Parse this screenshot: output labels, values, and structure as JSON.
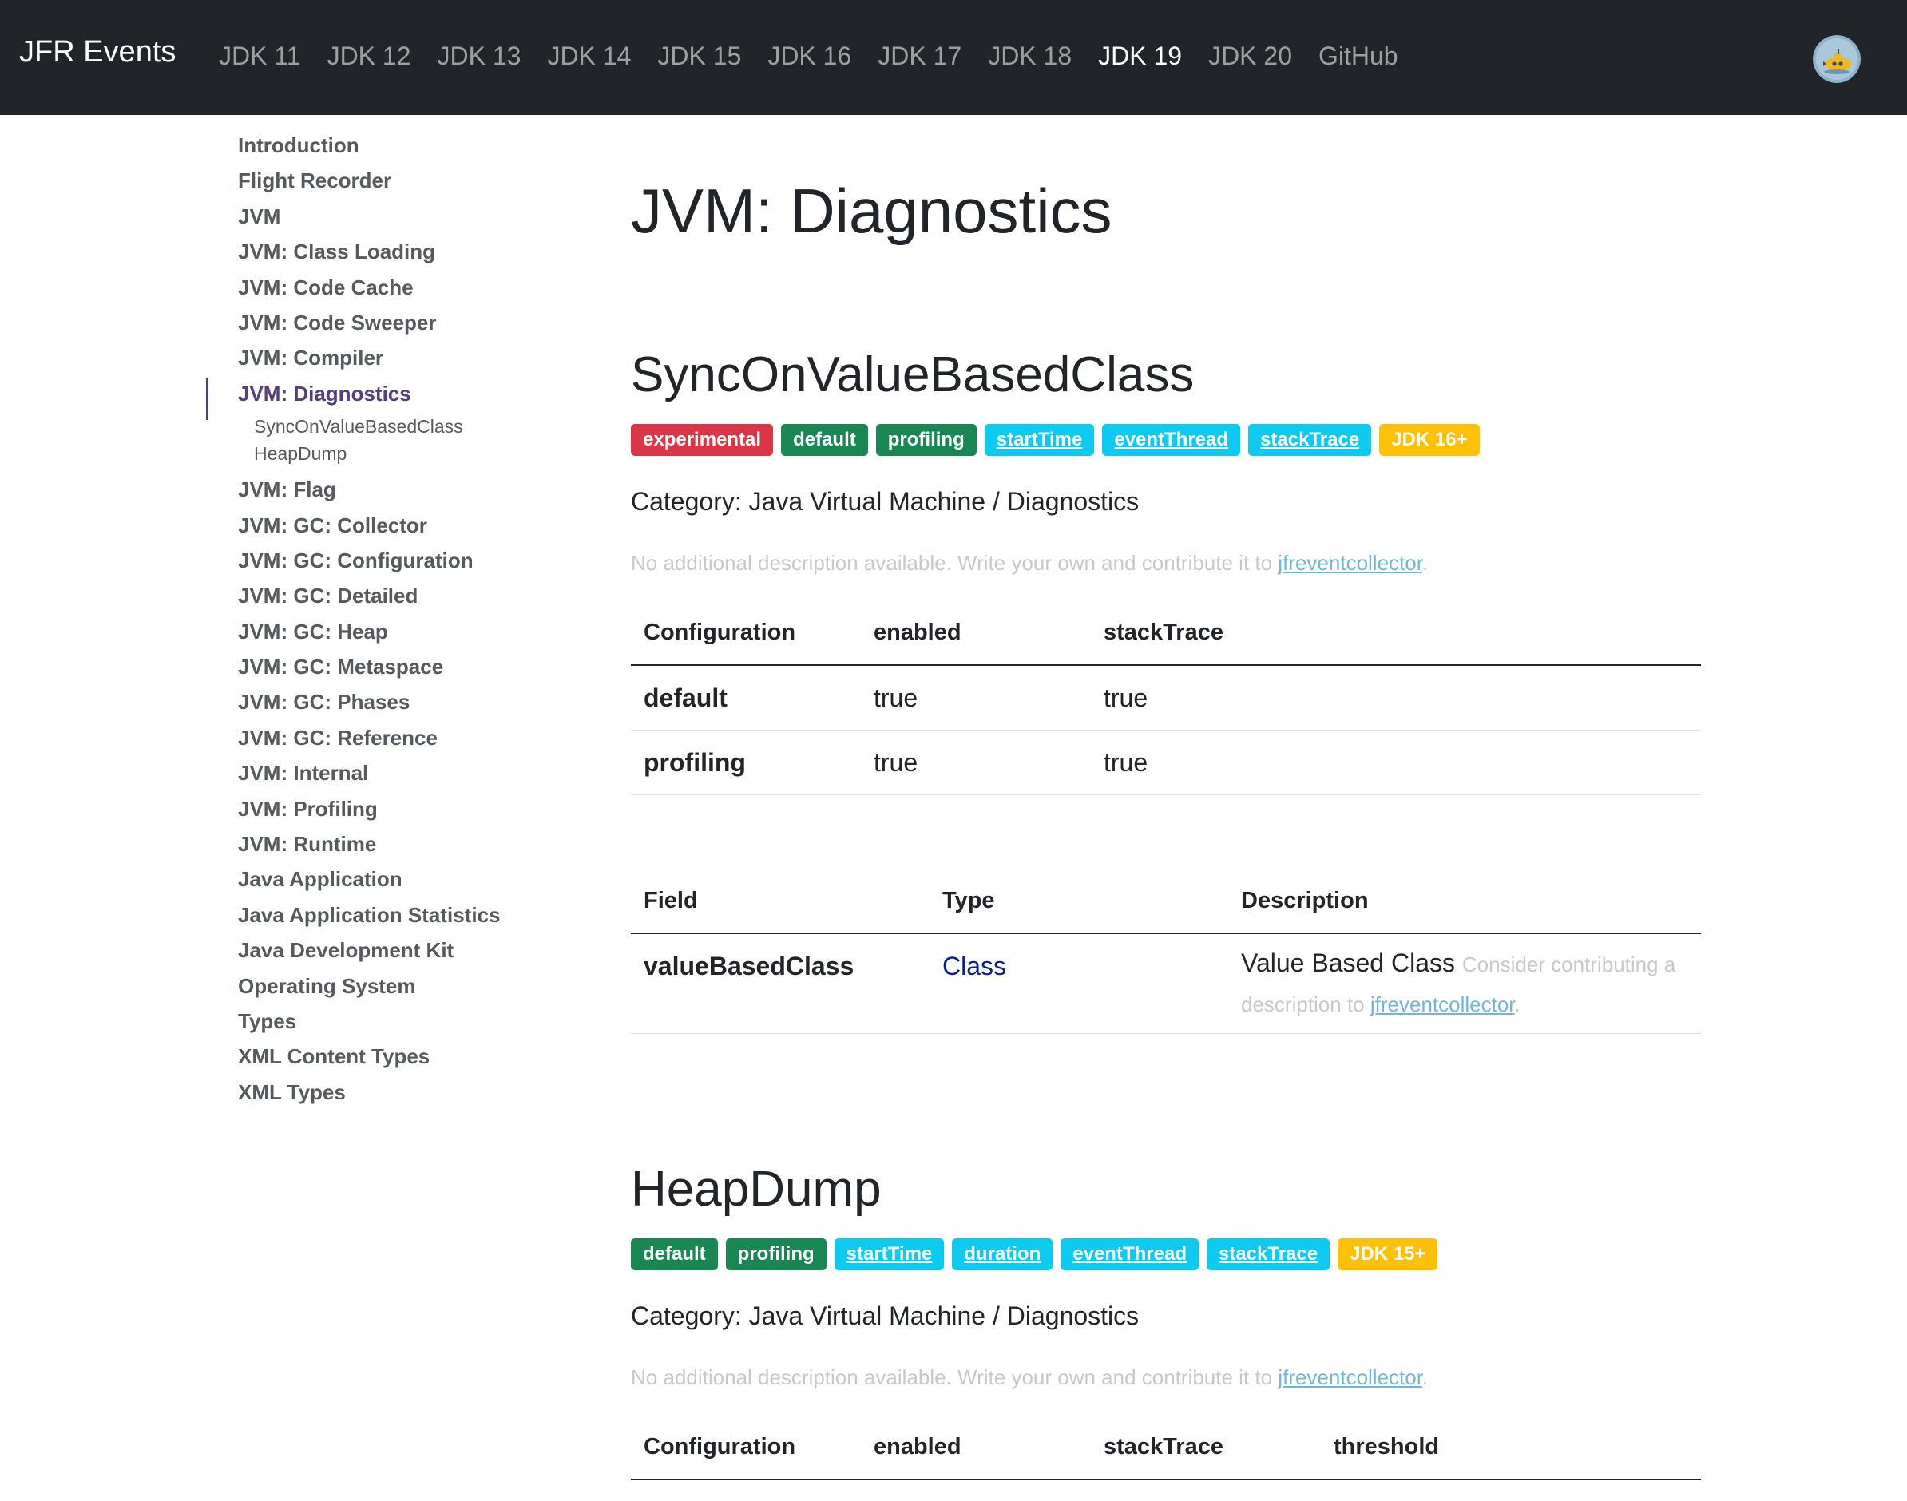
{
  "navbar": {
    "brand": "JFR Events",
    "links": [
      "JDK 11",
      "JDK 12",
      "JDK 13",
      "JDK 14",
      "JDK 15",
      "JDK 16",
      "JDK 17",
      "JDK 18",
      "JDK 19",
      "JDK 20",
      "GitHub"
    ],
    "active_link": "JDK 19",
    "avatar_icon": "submarine-avatar-icon"
  },
  "sidebar": {
    "items": [
      "Introduction",
      "Flight Recorder",
      "JVM",
      "JVM: Class Loading",
      "JVM: Code Cache",
      "JVM: Code Sweeper",
      "JVM: Compiler",
      "JVM: Diagnostics"
    ],
    "active_item": "JVM: Diagnostics",
    "sub_items": [
      "SyncOnValueBasedClass",
      "HeapDump"
    ],
    "items_after": [
      "JVM: Flag",
      "JVM: GC: Collector",
      "JVM: GC: Configuration",
      "JVM: GC: Detailed",
      "JVM: GC: Heap",
      "JVM: GC: Metaspace",
      "JVM: GC: Phases",
      "JVM: GC: Reference",
      "JVM: Internal",
      "JVM: Profiling",
      "JVM: Runtime",
      "Java Application",
      "Java Application Statistics",
      "Java Development Kit",
      "Operating System",
      "Types",
      "XML Content Types",
      "XML Types"
    ]
  },
  "main": {
    "page_title": "JVM: Diagnostics",
    "events": [
      {
        "title": "SyncOnValueBasedClass",
        "badges": [
          "experimental",
          "default",
          "profiling",
          "startTime",
          "eventThread",
          "stackTrace",
          "JDK 16+"
        ],
        "category_label": "Category: ",
        "category": "Java Virtual Machine / Diagnostics",
        "no_desc_text": "No additional description available. Write your own and contribute it to ",
        "no_desc_link": "jfreventcollector",
        "no_desc_end": ".",
        "config_headers": [
          "Configuration",
          "enabled",
          "stackTrace"
        ],
        "config_rows": [
          [
            "default",
            "true",
            "true"
          ],
          [
            "profiling",
            "true",
            "true"
          ]
        ],
        "field_headers": [
          "Field",
          "Type",
          "Description"
        ],
        "fields": [
          {
            "name": "valueBasedClass",
            "type": "Class",
            "desc": "Value Based Class",
            "contrib_text": "Consider contributing a description to ",
            "contrib_link": "jfreventcollector",
            "contrib_end": "."
          }
        ]
      },
      {
        "title": "HeapDump",
        "badges": [
          "default",
          "profiling",
          "startTime",
          "duration",
          "eventThread",
          "stackTrace",
          "JDK 15+"
        ],
        "category_label": "Category: ",
        "category": "Java Virtual Machine / Diagnostics",
        "no_desc_text": "No additional description available. Write your own and contribute it to ",
        "no_desc_link": "jfreventcollector",
        "no_desc_end": ".",
        "config_headers": [
          "Configuration",
          "enabled",
          "stackTrace",
          "threshold"
        ]
      }
    ]
  },
  "colors": {
    "navbar_bg": "#212529",
    "badge_danger": "#dc3545",
    "badge_success": "#198754",
    "badge_info": "#0dcaf0",
    "badge_warning": "#ffc107",
    "sidebar_active": "#563d7c",
    "type_link": "#0a1f8f"
  }
}
